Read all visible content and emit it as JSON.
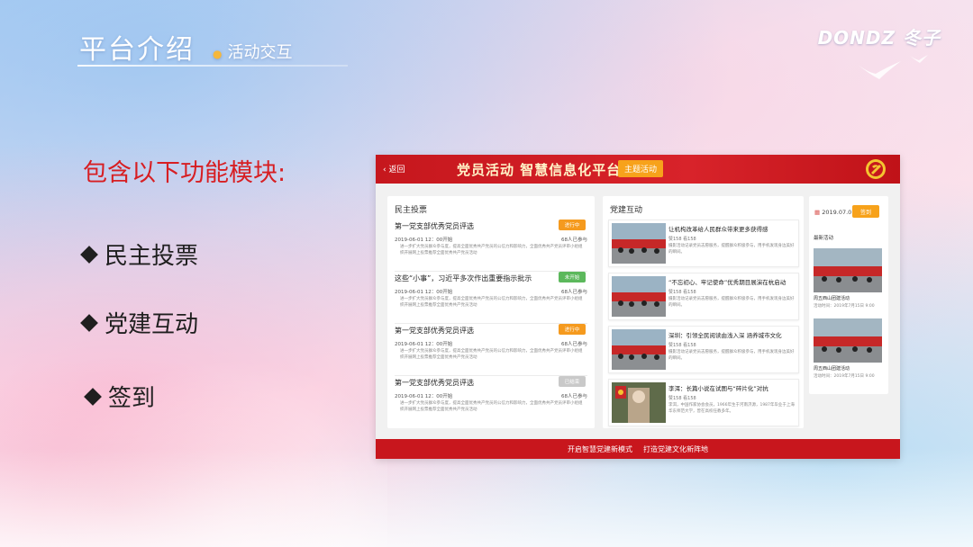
{
  "header": {
    "title": "平台介绍",
    "subtitle": "活动交互",
    "logo_text": "DONDZ 冬子"
  },
  "modules": {
    "heading": "包含以下功能模块:",
    "items": [
      {
        "label": "民主投票"
      },
      {
        "label": "党建互动"
      },
      {
        "label": "签到"
      }
    ]
  },
  "screenshot": {
    "back_label": "返回",
    "title": "党员活动 智慧信息化平台",
    "theme_button": "主题活动",
    "footer": {
      "left": "开启智慧党建新模式",
      "right": "打造党建文化新阵地"
    },
    "vote_panel": {
      "title": "民主投票",
      "items": [
        {
          "title": "第一党支部优秀党员评选",
          "date": "2019-06-01 12：00开始",
          "count": "68人已参与",
          "badge": "进行中",
          "badge_color": "#f59a1e",
          "desc": "进一步扩大党员群众参与度，提高全面优秀共产党员的公信力和影响力，全面优秀共产党员评审小组组织开展网上投票推荐全面优秀共产党员活动"
        },
        {
          "title": "这些“小事”，习近平多次作出重要指示批示",
          "date": "2019-06-01 12：00开始",
          "count": "68人已参与",
          "badge": "未开始",
          "badge_color": "#5cb85c",
          "desc": "进一步扩大党员群众参与度，提高全面优秀共产党员的公信力和影响力，全面优秀共产党员评审小组组织开展网上投票推荐全面优秀共产党员活动"
        },
        {
          "title": "第一党支部优秀党员评选",
          "date": "2019-06-01 12：00开始",
          "count": "68人已参与",
          "badge": "进行中",
          "badge_color": "#f59a1e",
          "desc": "进一步扩大党员群众参与度，提高全面优秀共产党员的公信力和影响力，全面优秀共产党员评审小组组织开展网上投票推荐全面优秀共产党员活动"
        },
        {
          "title": "第一党支部优秀党员评选",
          "date": "2019-06-01 12：00开始",
          "count": "68人已参与",
          "badge": "已结束",
          "badge_color": "#c9c9c9",
          "desc": "进一步扩大党员群众参与度，提高全面优秀共产党员的公信力和影响力，全面优秀共产党员评审小组组织开展网上投票推荐全面优秀共产党员活动"
        }
      ]
    },
    "news_panel": {
      "title": "党建互动",
      "items": [
        {
          "title": "让机构改革给人民群众带来更多获得感",
          "meta": "赞158  看158",
          "desc": "摄影活动记录党员志愿服务，提醒群众积极参与，用手机发现身边美好的瞬间。"
        },
        {
          "title": "“不忘初心、牢记使命”优秀期目展演在杭启动",
          "meta": "赞158  看158",
          "desc": "摄影活动记录党员志愿服务，提醒群众积极参与，用手机发现身边美好的瞬间。"
        },
        {
          "title": "深圳：引领全民阅读由浅入深 涵养城市文化",
          "meta": "赞158  看158",
          "desc": "摄影活动记录党员志愿服务，提醒群众积极参与，用手机发现身边美好的瞬间。"
        },
        {
          "title": "李洱：长篇小说在试图与“碎片化”对抗",
          "meta": "赞158  看158",
          "desc": "李洱，中国作家协会会员，1966年生于河南济源，1987年毕业于上海华东师范大学，曾在高校任教多年。"
        }
      ]
    },
    "side_panel": {
      "date": "2019.07.07",
      "sign_button": "签到",
      "recent_label": "最新活动",
      "items": [
        {
          "caption": "周五西山团建活动",
          "time": "活动时间：2019年7月15日 9:00"
        },
        {
          "caption": "周五西山团建活动",
          "time": "活动时间：2019年7月15日 9:00"
        }
      ]
    }
  },
  "colors": {
    "accent_red": "#d71e22",
    "nav_red": "#c8161d",
    "orange": "#f7a21b"
  }
}
